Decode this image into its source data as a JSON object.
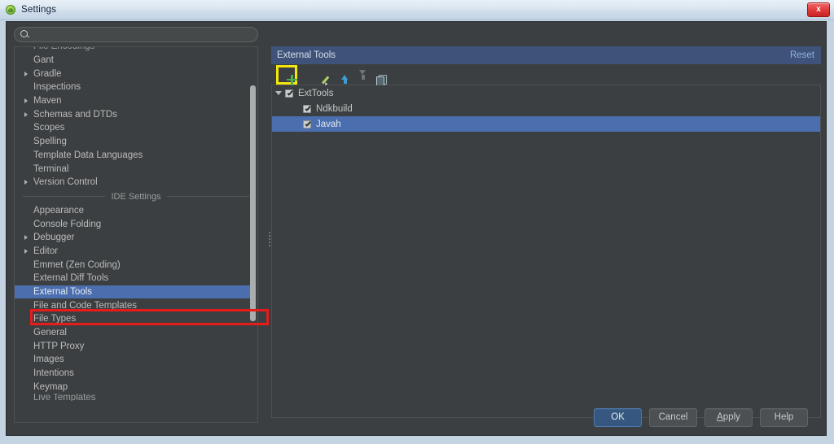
{
  "window": {
    "title": "Settings",
    "icon": "android-icon",
    "close_label": "x"
  },
  "search": {
    "placeholder": "",
    "value": "",
    "icon": "search-icon"
  },
  "sidebar": {
    "clipped_top_item": "File Encodings",
    "clipped_bottom_item": "Live Templates",
    "separator_label": "IDE Settings",
    "project_items": [
      {
        "label": "Gant",
        "expandable": false,
        "selected": false
      },
      {
        "label": "Gradle",
        "expandable": true,
        "selected": false
      },
      {
        "label": "Inspections",
        "expandable": false,
        "selected": false
      },
      {
        "label": "Maven",
        "expandable": true,
        "selected": false
      },
      {
        "label": "Schemas and DTDs",
        "expandable": true,
        "selected": false
      },
      {
        "label": "Scopes",
        "expandable": false,
        "selected": false
      },
      {
        "label": "Spelling",
        "expandable": false,
        "selected": false
      },
      {
        "label": "Template Data Languages",
        "expandable": false,
        "selected": false
      },
      {
        "label": "Terminal",
        "expandable": false,
        "selected": false
      },
      {
        "label": "Version Control",
        "expandable": true,
        "selected": false
      }
    ],
    "ide_items": [
      {
        "label": "Appearance",
        "expandable": false,
        "selected": false
      },
      {
        "label": "Console Folding",
        "expandable": false,
        "selected": false
      },
      {
        "label": "Debugger",
        "expandable": true,
        "selected": false
      },
      {
        "label": "Editor",
        "expandable": true,
        "selected": false
      },
      {
        "label": "Emmet (Zen Coding)",
        "expandable": false,
        "selected": false
      },
      {
        "label": "External Diff Tools",
        "expandable": false,
        "selected": false
      },
      {
        "label": "External Tools",
        "expandable": false,
        "selected": true
      },
      {
        "label": "File and Code Templates",
        "expandable": false,
        "selected": false
      },
      {
        "label": "File Types",
        "expandable": false,
        "selected": false
      },
      {
        "label": "General",
        "expandable": false,
        "selected": false
      },
      {
        "label": "HTTP Proxy",
        "expandable": false,
        "selected": false
      },
      {
        "label": "Images",
        "expandable": false,
        "selected": false
      },
      {
        "label": "Intentions",
        "expandable": false,
        "selected": false
      },
      {
        "label": "Keymap",
        "expandable": false,
        "selected": false
      }
    ]
  },
  "panel": {
    "title": "External Tools",
    "reset_label": "Reset",
    "toolbar": [
      {
        "name": "add-button",
        "icon": "plus-icon",
        "highlighted": true
      },
      {
        "name": "remove-button",
        "icon": "minus-icon",
        "highlighted": false
      },
      {
        "name": "edit-button",
        "icon": "pencil-icon",
        "highlighted": false
      },
      {
        "name": "move-up-button",
        "icon": "arrow-up-icon",
        "highlighted": false
      },
      {
        "name": "move-down-button",
        "icon": "arrow-down-icon",
        "highlighted": false
      },
      {
        "name": "copy-button",
        "icon": "copy-icon",
        "highlighted": false
      }
    ],
    "tree": [
      {
        "label": "ExtTools",
        "level": 0,
        "expanded": true,
        "checked": true,
        "selected": false
      },
      {
        "label": "Ndkbuild",
        "level": 1,
        "expanded": null,
        "checked": true,
        "selected": false
      },
      {
        "label": "Javah",
        "level": 1,
        "expanded": null,
        "checked": true,
        "selected": true
      }
    ]
  },
  "footer": {
    "buttons": [
      {
        "label": "OK",
        "primary": true
      },
      {
        "label": "Cancel",
        "primary": false
      },
      {
        "label": "Apply",
        "primary": false,
        "mnemonic": "A"
      },
      {
        "label": "Help",
        "primary": false
      }
    ]
  },
  "annotations": {
    "red_highlight_target": "External Tools",
    "yellow_highlight_target": "add-button",
    "red_color": "#e81b1b",
    "yellow_color": "#f2e60c",
    "accent_color": "#4b6eaf"
  }
}
